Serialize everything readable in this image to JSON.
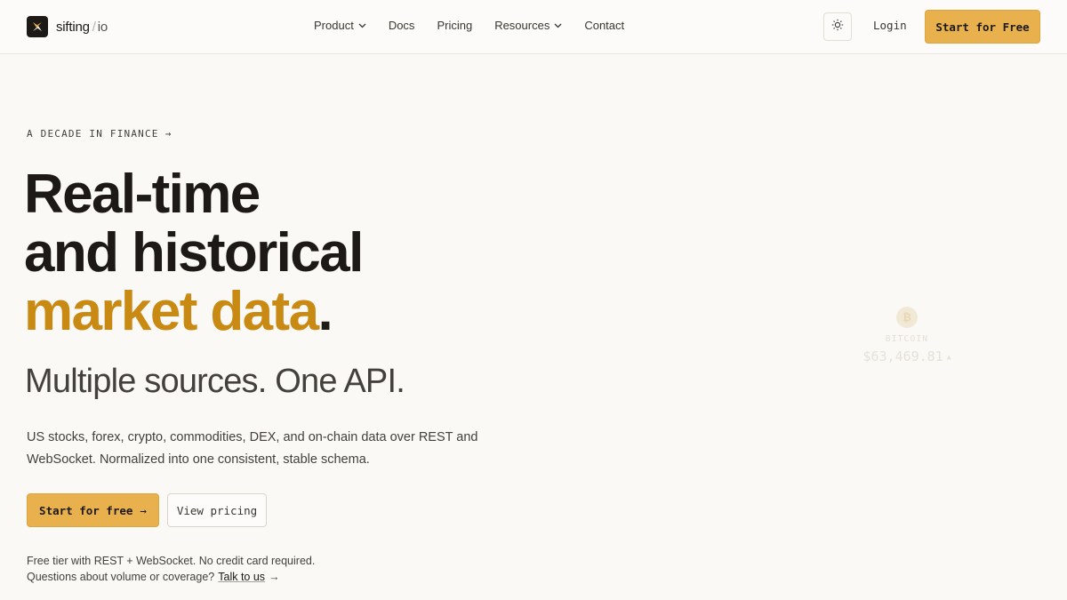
{
  "brand": {
    "name": "sifting",
    "slash": "/",
    "suffix": "io"
  },
  "nav": {
    "items": [
      {
        "label": "Product",
        "dropdown": true
      },
      {
        "label": "Docs",
        "dropdown": false
      },
      {
        "label": "Pricing",
        "dropdown": false
      },
      {
        "label": "Resources",
        "dropdown": true
      },
      {
        "label": "Contact",
        "dropdown": false
      }
    ],
    "theme_icon": "sun-icon",
    "login_label": "Login",
    "cta_label": "Start for Free"
  },
  "hero": {
    "eyebrow": "A DECADE IN FINANCE",
    "headline_line1": "Real-time",
    "headline_line2": "and historical",
    "headline_accent": "market data",
    "headline_dot": ".",
    "subhead": "Multiple sources. One API.",
    "description": "US stocks, forex, crypto, commodities, DEX, and on-chain data over REST and WebSocket. Normalized into one consistent, stable schema.",
    "primary_button": "Start for free",
    "secondary_button": "View pricing",
    "note_line1": "Free tier with REST + WebSocket. No credit card required.",
    "note_line2_prefix": "Questions about volume or coverage?",
    "note_link": "Talk to us"
  },
  "ticker": {
    "coin_symbol": "₿",
    "name": "BITCOIN",
    "price": "$63,469.81"
  },
  "colors": {
    "accent": "#e8b14d",
    "headline_accent": "#c98a14",
    "background": "#faf9f6",
    "text": "#1c1917"
  }
}
